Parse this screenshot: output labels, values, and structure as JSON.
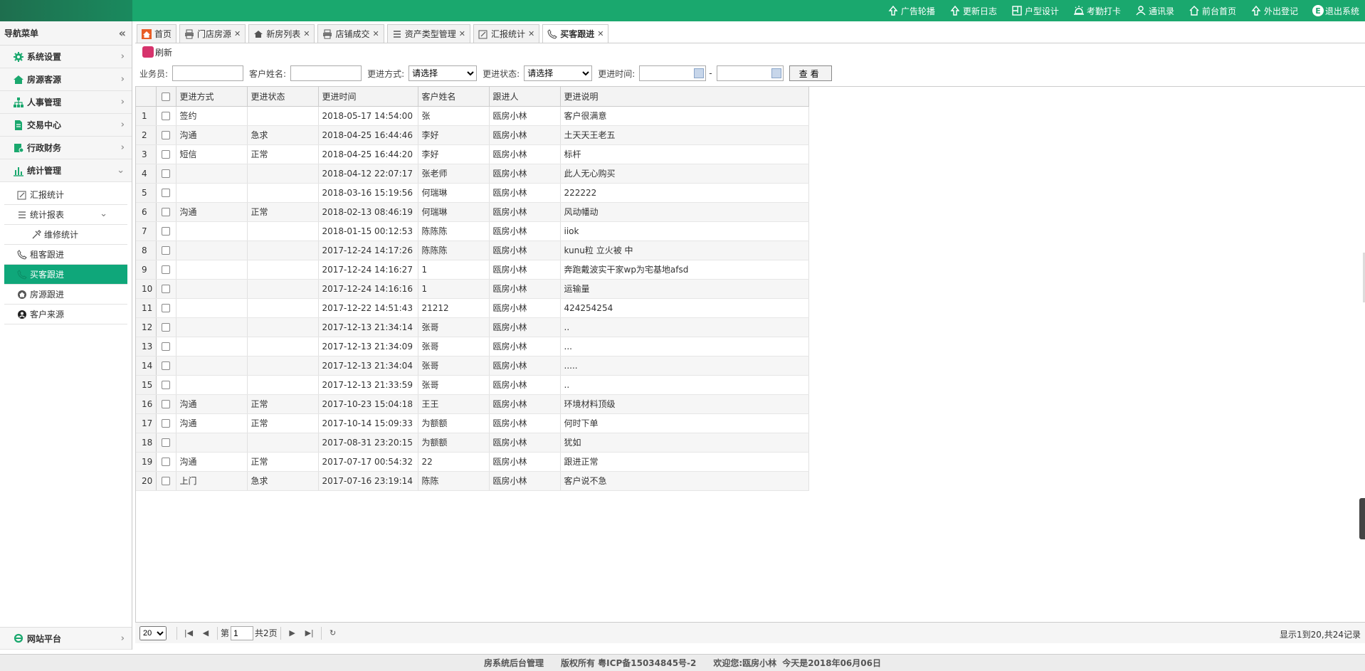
{
  "topbar": {
    "items": [
      {
        "label": "广告轮播",
        "icon": "upload-icon"
      },
      {
        "label": "更新日志",
        "icon": "upload-icon"
      },
      {
        "label": "户型设计",
        "icon": "floorplan-icon"
      },
      {
        "label": "考勤打卡",
        "icon": "alarm-icon"
      },
      {
        "label": "通讯录",
        "icon": "user-icon"
      },
      {
        "label": "前台首页",
        "icon": "home-icon"
      },
      {
        "label": "外出登记",
        "icon": "upload-icon"
      },
      {
        "label": "退出系统",
        "icon": "logout-icon"
      }
    ]
  },
  "sidebar": {
    "title": "导航菜单",
    "menus": [
      {
        "label": "系统设置",
        "icon": "gear-icon"
      },
      {
        "label": "房源客源",
        "icon": "house-icon"
      },
      {
        "label": "人事管理",
        "icon": "org-icon"
      },
      {
        "label": "交易中心",
        "icon": "document-icon"
      },
      {
        "label": "行政财务",
        "icon": "finance-icon"
      },
      {
        "label": "统计管理",
        "icon": "bar-chart-icon"
      }
    ],
    "submenus": [
      {
        "label": "汇报统计",
        "icon": "edit-icon"
      },
      {
        "label": "统计报表",
        "icon": "list-icon"
      },
      {
        "label": "维修统计",
        "icon": "tools-icon"
      },
      {
        "label": "租客跟进",
        "icon": "phone-icon"
      },
      {
        "label": "买客跟进",
        "icon": "phone-icon"
      },
      {
        "label": "房源跟进",
        "icon": "house-circle-icon"
      },
      {
        "label": "客户来源",
        "icon": "source-icon"
      }
    ],
    "bottom": {
      "label": "网站平台",
      "icon": "ie-icon"
    }
  },
  "tabs": [
    {
      "label": "首页",
      "closable": false
    },
    {
      "label": "门店房源",
      "closable": true
    },
    {
      "label": "新房列表",
      "closable": true
    },
    {
      "label": "店铺成交",
      "closable": true
    },
    {
      "label": "资产类型管理",
      "closable": true
    },
    {
      "label": "汇报统计",
      "closable": true
    },
    {
      "label": "买客跟进",
      "closable": true
    }
  ],
  "toolbar": {
    "refresh_label": "刷新"
  },
  "filter": {
    "salesman_label": "业务员:",
    "customer_label": "客户姓名:",
    "method_label": "更进方式:",
    "method_value": "请选择",
    "status_label": "更进状态:",
    "status_value": "请选择",
    "time_label": "更进时间:",
    "dash": "-",
    "search_label": "查看"
  },
  "table": {
    "headers": [
      "更进方式",
      "更进状态",
      "更进时间",
      "客户姓名",
      "跟进人",
      "更进说明"
    ],
    "rows": [
      {
        "n": "1",
        "method": "签约",
        "status": "",
        "time": "2018-05-17 14:54:00",
        "customer": "张",
        "follower": "瓯房小林",
        "note": "客户很满意"
      },
      {
        "n": "2",
        "method": "沟通",
        "status": "急求",
        "time": "2018-04-25 16:44:46",
        "customer": "李好",
        "follower": "瓯房小林",
        "note": "土天天王老五"
      },
      {
        "n": "3",
        "method": "短信",
        "status": "正常",
        "time": "2018-04-25 16:44:20",
        "customer": "李好",
        "follower": "瓯房小林",
        "note": "标杆"
      },
      {
        "n": "4",
        "method": "",
        "status": "",
        "time": "2018-04-12 22:07:17",
        "customer": "张老师",
        "follower": "瓯房小林",
        "note": "此人无心购买"
      },
      {
        "n": "5",
        "method": "",
        "status": "",
        "time": "2018-03-16 15:19:56",
        "customer": "何瑞琳",
        "follower": "瓯房小林",
        "note": "222222"
      },
      {
        "n": "6",
        "method": "沟通",
        "status": "正常",
        "time": "2018-02-13 08:46:19",
        "customer": "何瑞琳",
        "follower": "瓯房小林",
        "note": "风动幡动"
      },
      {
        "n": "7",
        "method": "",
        "status": "",
        "time": "2018-01-15 00:12:53",
        "customer": "陈陈陈",
        "follower": "瓯房小林",
        "note": "iiok"
      },
      {
        "n": "8",
        "method": "",
        "status": "",
        "time": "2017-12-24 14:17:26",
        "customer": "陈陈陈",
        "follower": "瓯房小林",
        "note": "kunu粒 立火被 中"
      },
      {
        "n": "9",
        "method": "",
        "status": "",
        "time": "2017-12-24 14:16:27",
        "customer": "1",
        "follower": "瓯房小林",
        "note": "奔跑戴波实干家wp为宅基地afsd"
      },
      {
        "n": "10",
        "method": "",
        "status": "",
        "time": "2017-12-24 14:16:16",
        "customer": "1",
        "follower": "瓯房小林",
        "note": "运输量"
      },
      {
        "n": "11",
        "method": "",
        "status": "",
        "time": "2017-12-22 14:51:43",
        "customer": "21212",
        "follower": "瓯房小林",
        "note": "424254254"
      },
      {
        "n": "12",
        "method": "",
        "status": "",
        "time": "2017-12-13 21:34:14",
        "customer": "张哥",
        "follower": "瓯房小林",
        "note": ".."
      },
      {
        "n": "13",
        "method": "",
        "status": "",
        "time": "2017-12-13 21:34:09",
        "customer": "张哥",
        "follower": "瓯房小林",
        "note": "..."
      },
      {
        "n": "14",
        "method": "",
        "status": "",
        "time": "2017-12-13 21:34:04",
        "customer": "张哥",
        "follower": "瓯房小林",
        "note": "....."
      },
      {
        "n": "15",
        "method": "",
        "status": "",
        "time": "2017-12-13 21:33:59",
        "customer": "张哥",
        "follower": "瓯房小林",
        "note": ".."
      },
      {
        "n": "16",
        "method": "沟通",
        "status": "正常",
        "time": "2017-10-23 15:04:18",
        "customer": "王王",
        "follower": "瓯房小林",
        "note": "环境材料顶级"
      },
      {
        "n": "17",
        "method": "沟通",
        "status": "正常",
        "time": "2017-10-14 15:09:33",
        "customer": "为额额",
        "follower": "瓯房小林",
        "note": "何时下单"
      },
      {
        "n": "18",
        "method": "",
        "status": "",
        "time": "2017-08-31 23:20:15",
        "customer": "为额额",
        "follower": "瓯房小林",
        "note": "犹如"
      },
      {
        "n": "19",
        "method": "沟通",
        "status": "正常",
        "time": "2017-07-17 00:54:32",
        "customer": "22",
        "follower": "瓯房小林",
        "note": "跟进正常"
      },
      {
        "n": "20",
        "method": "上门",
        "status": "急求",
        "time": "2017-07-16 23:19:14",
        "customer": "陈陈",
        "follower": "瓯房小林",
        "note": "客户说不急"
      }
    ]
  },
  "pager": {
    "page_size": "20",
    "page_prefix": "第",
    "page_value": "1",
    "page_suffix": "共2页",
    "info": "显示1到20,共24记录"
  },
  "footer": {
    "system": "房系统后台管理",
    "copyright": "版权所有 粤ICP备15034845号-2",
    "welcome": "欢迎您:瓯房小林",
    "today": "今天是2018年06月06日"
  },
  "colors": {
    "brand": "#1aa86e",
    "active": "#0fa77a"
  }
}
